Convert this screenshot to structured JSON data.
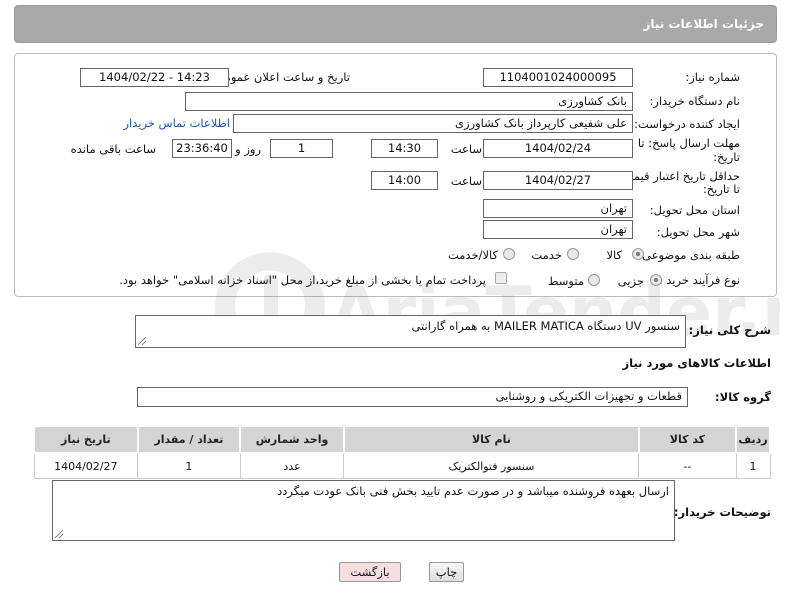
{
  "header": {
    "title": "جزئیات اطلاعات نیاز"
  },
  "form": {
    "need_number_label": "شماره نیاز:",
    "need_number": "1104001024000095",
    "announce_label": "تاریخ و ساعت اعلان عمومی:",
    "announce_value": "1404/02/22 - 14:23",
    "buyer_org_label": "نام دستگاه خریدار:",
    "buyer_org": "بانک کشاورزی",
    "requester_label": "ایجاد کننده درخواست:",
    "requester": "علی شفیعی کارپرداز بانک کشاورزی",
    "contact_link": "اطلاعات تماس خریدار",
    "deadline_label_1": "مهلت ارسال پاسخ: تا",
    "deadline_label_2": "تاریخ:",
    "deadline_date": "1404/02/24",
    "time_label": "ساعت",
    "deadline_time": "14:30",
    "days_value": "1",
    "days_label": "روز و",
    "remaining_time": "23:36:40",
    "remaining_label": "ساعت باقی مانده",
    "validity_label_1": "حداقل تاریخ اعتبار قیمت:",
    "validity_label_2": "تا تاریخ:",
    "validity_date": "1404/02/27",
    "validity_time": "14:00",
    "province_label": "استان محل تحویل:",
    "province": "تهران",
    "city_label": "شهر محل تحویل:",
    "city": "تهران",
    "category_label": "طبقه بندی موضوعی:",
    "category_options": [
      "کالا",
      "خدمت",
      "کالا/خدمت"
    ],
    "category_selected": "کالا",
    "process_label": "نوع فرآیند خرید :",
    "process_options": [
      "جزیی",
      "متوسط"
    ],
    "process_selected": "جزیی",
    "payment_note": "پرداخت تمام یا بخشی از مبلغ خرید،از محل \"اسناد خزانه اسلامی\" خواهد بود."
  },
  "description": {
    "label": "شرح کلی نیاز:",
    "value": "سنسور UV دستگاه MAILER MATICA به همراه گارانتی"
  },
  "goods_section_title": "اطلاعات کالاهای مورد نیاز",
  "goods_group": {
    "label": "گروه کالا:",
    "value": "قطعات و تجهیزات الکتریکی و روشنایی"
  },
  "table": {
    "headers": [
      "ردیف",
      "کد کالا",
      "نام کالا",
      "واحد شمارش",
      "تعداد / مقدار",
      "تاریخ نیاز"
    ],
    "rows": [
      [
        "1",
        "--",
        "سنسور فتوالکتریک",
        "عدد",
        "1",
        "1404/02/27"
      ]
    ]
  },
  "buyer_notes": {
    "label": "توضیحات خریدار:",
    "value": "ارسال بعهده فروشنده میباشد و در صورت عدم تایید بخش فنی بانک عودت میگردد"
  },
  "buttons": {
    "print": "چاپ",
    "back": "بازگشت"
  },
  "watermark": "AriaTender.neT",
  "colors": {
    "header_bg": "#a9a9a9",
    "link": "#1a55c8",
    "back_button_bg": "#f6dede"
  }
}
